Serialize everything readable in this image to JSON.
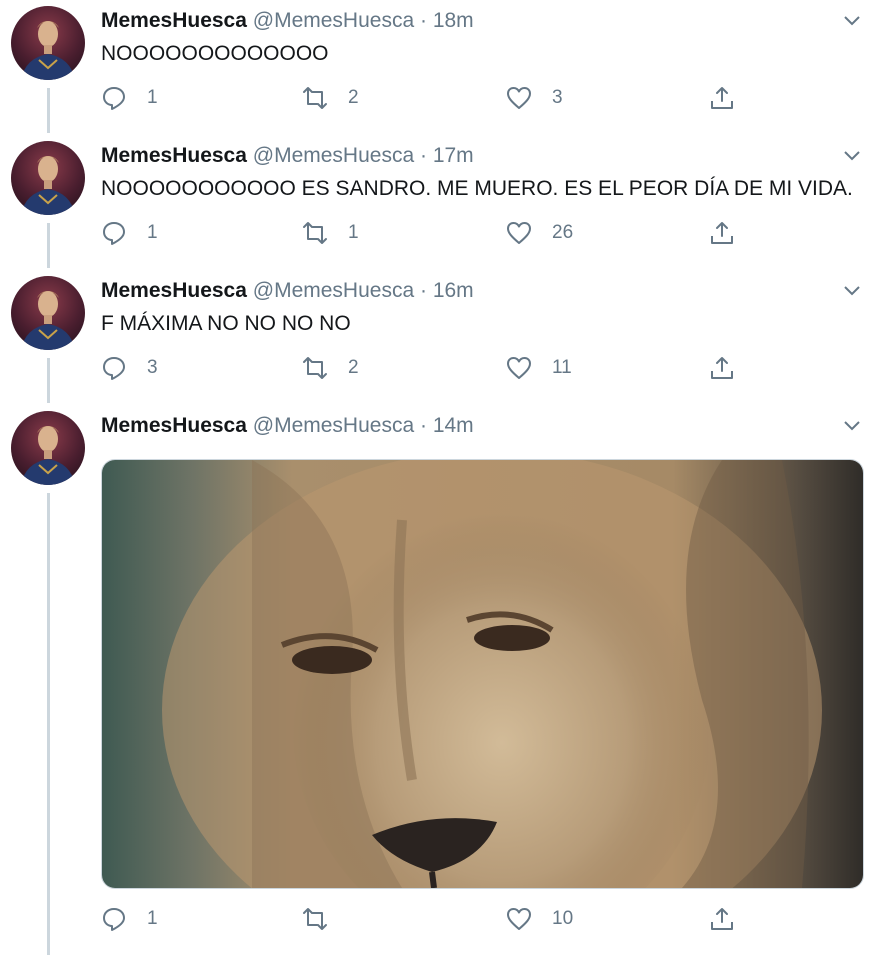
{
  "tweets": [
    {
      "name": "MemesHuesca",
      "handle": "@MemesHuesca",
      "time": "18m",
      "text": "NOOOOOOOOOOOOO",
      "replies": "1",
      "retweets": "2",
      "likes": "3"
    },
    {
      "name": "MemesHuesca",
      "handle": "@MemesHuesca",
      "time": "17m",
      "text": "NOOOOOOOOOOO ES SANDRO. ME MUERO. ES EL PEOR DÍA DE MI VIDA.",
      "replies": "1",
      "retweets": "1",
      "likes": "26"
    },
    {
      "name": "MemesHuesca",
      "handle": "@MemesHuesca",
      "time": "16m",
      "text": "F MÁXIMA NO NO NO NO",
      "replies": "3",
      "retweets": "2",
      "likes": "11"
    },
    {
      "name": "MemesHuesca",
      "handle": "@MemesHuesca",
      "time": "14m",
      "text": "",
      "replies": "1",
      "retweets": "",
      "likes": "10"
    }
  ],
  "separator": " · ",
  "colors": {
    "text": "#14171a",
    "secondary": "#657786",
    "thread_line": "#ccd6dd"
  },
  "icons": [
    "reply-icon",
    "retweet-icon",
    "like-icon",
    "share-icon",
    "chevron-down-icon"
  ]
}
